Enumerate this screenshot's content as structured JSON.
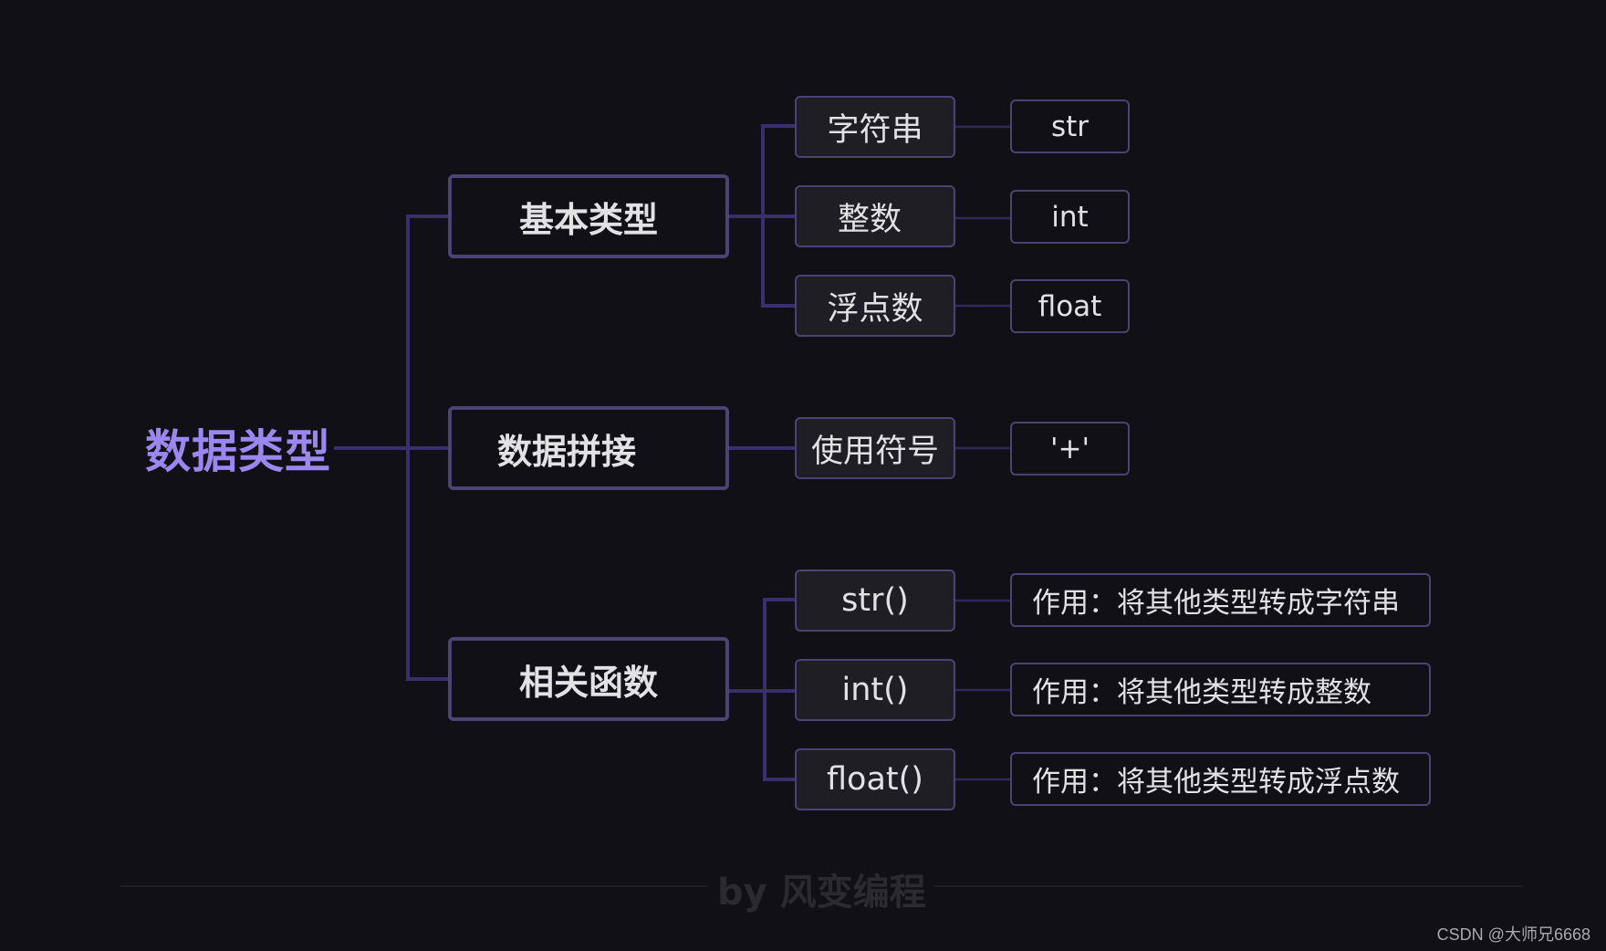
{
  "diagram": {
    "root": {
      "label": "数据类型"
    },
    "branches": [
      {
        "label": "基本类型",
        "children": [
          {
            "label": "字符串",
            "detail": "str"
          },
          {
            "label": "整数",
            "detail": "int"
          },
          {
            "label": "浮点数",
            "detail": "float"
          }
        ]
      },
      {
        "label": "数据拼接",
        "children": [
          {
            "label": "使用符号",
            "detail": "'+'"
          }
        ]
      },
      {
        "label": "相关函数",
        "children": [
          {
            "label": "str()",
            "detail": "作用：将其他类型转成字符串"
          },
          {
            "label": "int()",
            "detail": "作用：将其他类型转成整数"
          },
          {
            "label": "float()",
            "detail": "作用：将其他类型转成浮点数"
          }
        ]
      }
    ]
  },
  "footer": {
    "credit": "by 风变编程"
  },
  "watermark": "CSDN @大师兄6668",
  "colors": {
    "background": "#111016",
    "accent": "#9b87ef",
    "connector": "#3a2f6e",
    "border": "#4b4373",
    "node_text": "#e2e2e4"
  }
}
